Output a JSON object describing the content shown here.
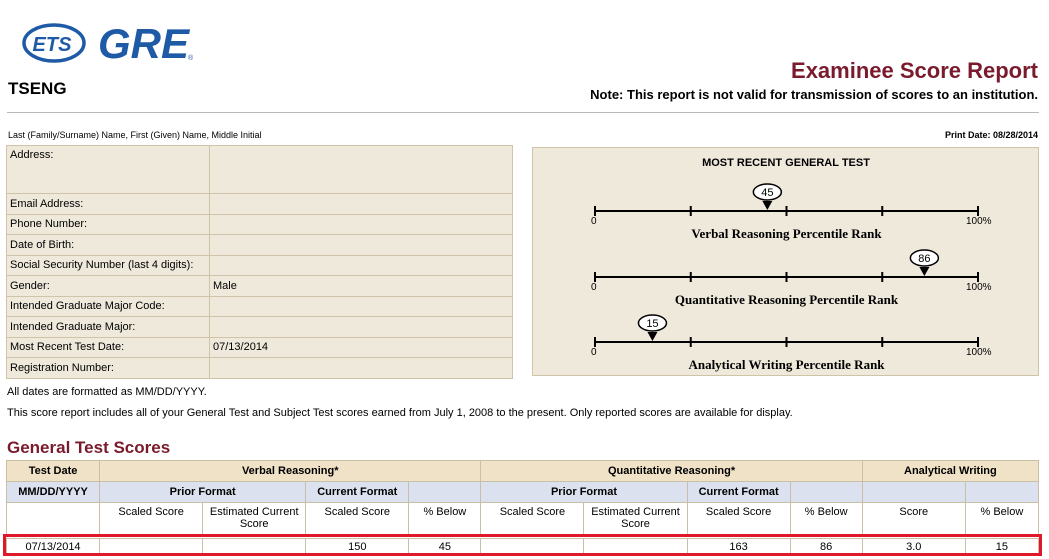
{
  "header": {
    "brand_ets": "ETS",
    "brand_gre": "GRE",
    "registered_mark": "®",
    "examinee_name": "TSENG",
    "report_title": "Examinee Score Report",
    "report_note": "Note: This report is not valid for transmission of scores to an institution."
  },
  "name_caption": "Last (Family/Surname) Name, First (Given) Name, Middle Initial",
  "print_date": "Print Date: 08/28/2014",
  "info": [
    {
      "label": "Address:",
      "value": ""
    },
    {
      "label": "Email Address:",
      "value": ""
    },
    {
      "label": "Phone Number:",
      "value": ""
    },
    {
      "label": "Date of Birth:",
      "value": ""
    },
    {
      "label": "Social Security Number (last 4 digits):",
      "value": ""
    },
    {
      "label": "Gender:",
      "value": "Male"
    },
    {
      "label": "Intended Graduate Major Code:",
      "value": ""
    },
    {
      "label": "Intended Graduate Major:",
      "value": ""
    },
    {
      "label": "Most Recent Test Date:",
      "value": "07/13/2014"
    },
    {
      "label": "Registration Number:",
      "value": ""
    }
  ],
  "percentiles": {
    "title": "MOST RECENT GENERAL TEST",
    "min_label": "0",
    "max_label": "100%",
    "scales": [
      {
        "label": "Verbal Reasoning Percentile Rank",
        "value": 45
      },
      {
        "label": "Quantitative Reasoning Percentile Rank",
        "value": 86
      },
      {
        "label": "Analytical Writing Percentile Rank",
        "value": 15
      }
    ]
  },
  "notes": {
    "date_format": "All dates are formatted as MM/DD/YYYY.",
    "scope": "This score report includes all of your General Test and Subject Test scores earned from July 1, 2008 to the present. Only reported scores are available for display."
  },
  "scores": {
    "section_title": "General Test Scores",
    "groups": {
      "test_date": "Test Date",
      "verbal": "Verbal Reasoning*",
      "quant": "Quantitative Reasoning*",
      "writing": "Analytical Writing"
    },
    "subgroups": {
      "date_format": "MM/DD/YYYY",
      "prior_format": "Prior Format",
      "current_format": "Current Format"
    },
    "columns": {
      "scaled_score": "Scaled Score",
      "estimated_current_score": "Estimated Current Score",
      "pct_below": "% Below",
      "score": "Score"
    },
    "rows": [
      {
        "date": "07/13/2014",
        "verbal_prior_scaled": "",
        "verbal_prior_estimated": "",
        "verbal_current_scaled": "150",
        "verbal_pct_below": "45",
        "quant_prior_scaled": "",
        "quant_prior_estimated": "",
        "quant_current_scaled": "163",
        "quant_pct_below": "86",
        "writing_score": "3.0",
        "writing_pct_below": "15"
      }
    ]
  },
  "colors": {
    "accent": "#7a1b2d",
    "ets_blue": "#1f5aa6",
    "panel_bg": "#efe9dc",
    "header_bg": "#efe2c6",
    "subheader_bg": "#dbe1ee",
    "highlight": "#e0162b"
  }
}
